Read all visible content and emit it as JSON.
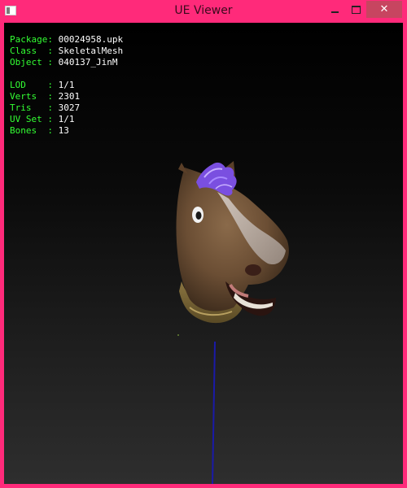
{
  "window": {
    "title": "UE Viewer",
    "controls": {
      "minimize": "",
      "maximize": "",
      "close": "✕"
    }
  },
  "info": {
    "package": {
      "label": "Package: ",
      "value": "00024958.upk"
    },
    "class": {
      "label": "Class  : ",
      "value": "SkeletalMesh"
    },
    "object": {
      "label": "Object : ",
      "value": "040137_JinM"
    },
    "lod": {
      "label": "LOD    : ",
      "value": "1/1"
    },
    "verts": {
      "label": "Verts  : ",
      "value": "2301"
    },
    "tris": {
      "label": "Tris   : ",
      "value": "3027"
    },
    "uv_set": {
      "label": "UV Set : ",
      "value": "1/1"
    },
    "bones": {
      "label": "Bones  : ",
      "value": "13"
    }
  },
  "colors": {
    "frame": "#ff2a7a",
    "info_label": "#33ff33",
    "info_value": "#ffffff",
    "axis_line": "#1a1aa8",
    "mane": "#7a4fe0",
    "head": "#6b4e34"
  },
  "scene": {
    "model": "horse-head-mesh"
  }
}
